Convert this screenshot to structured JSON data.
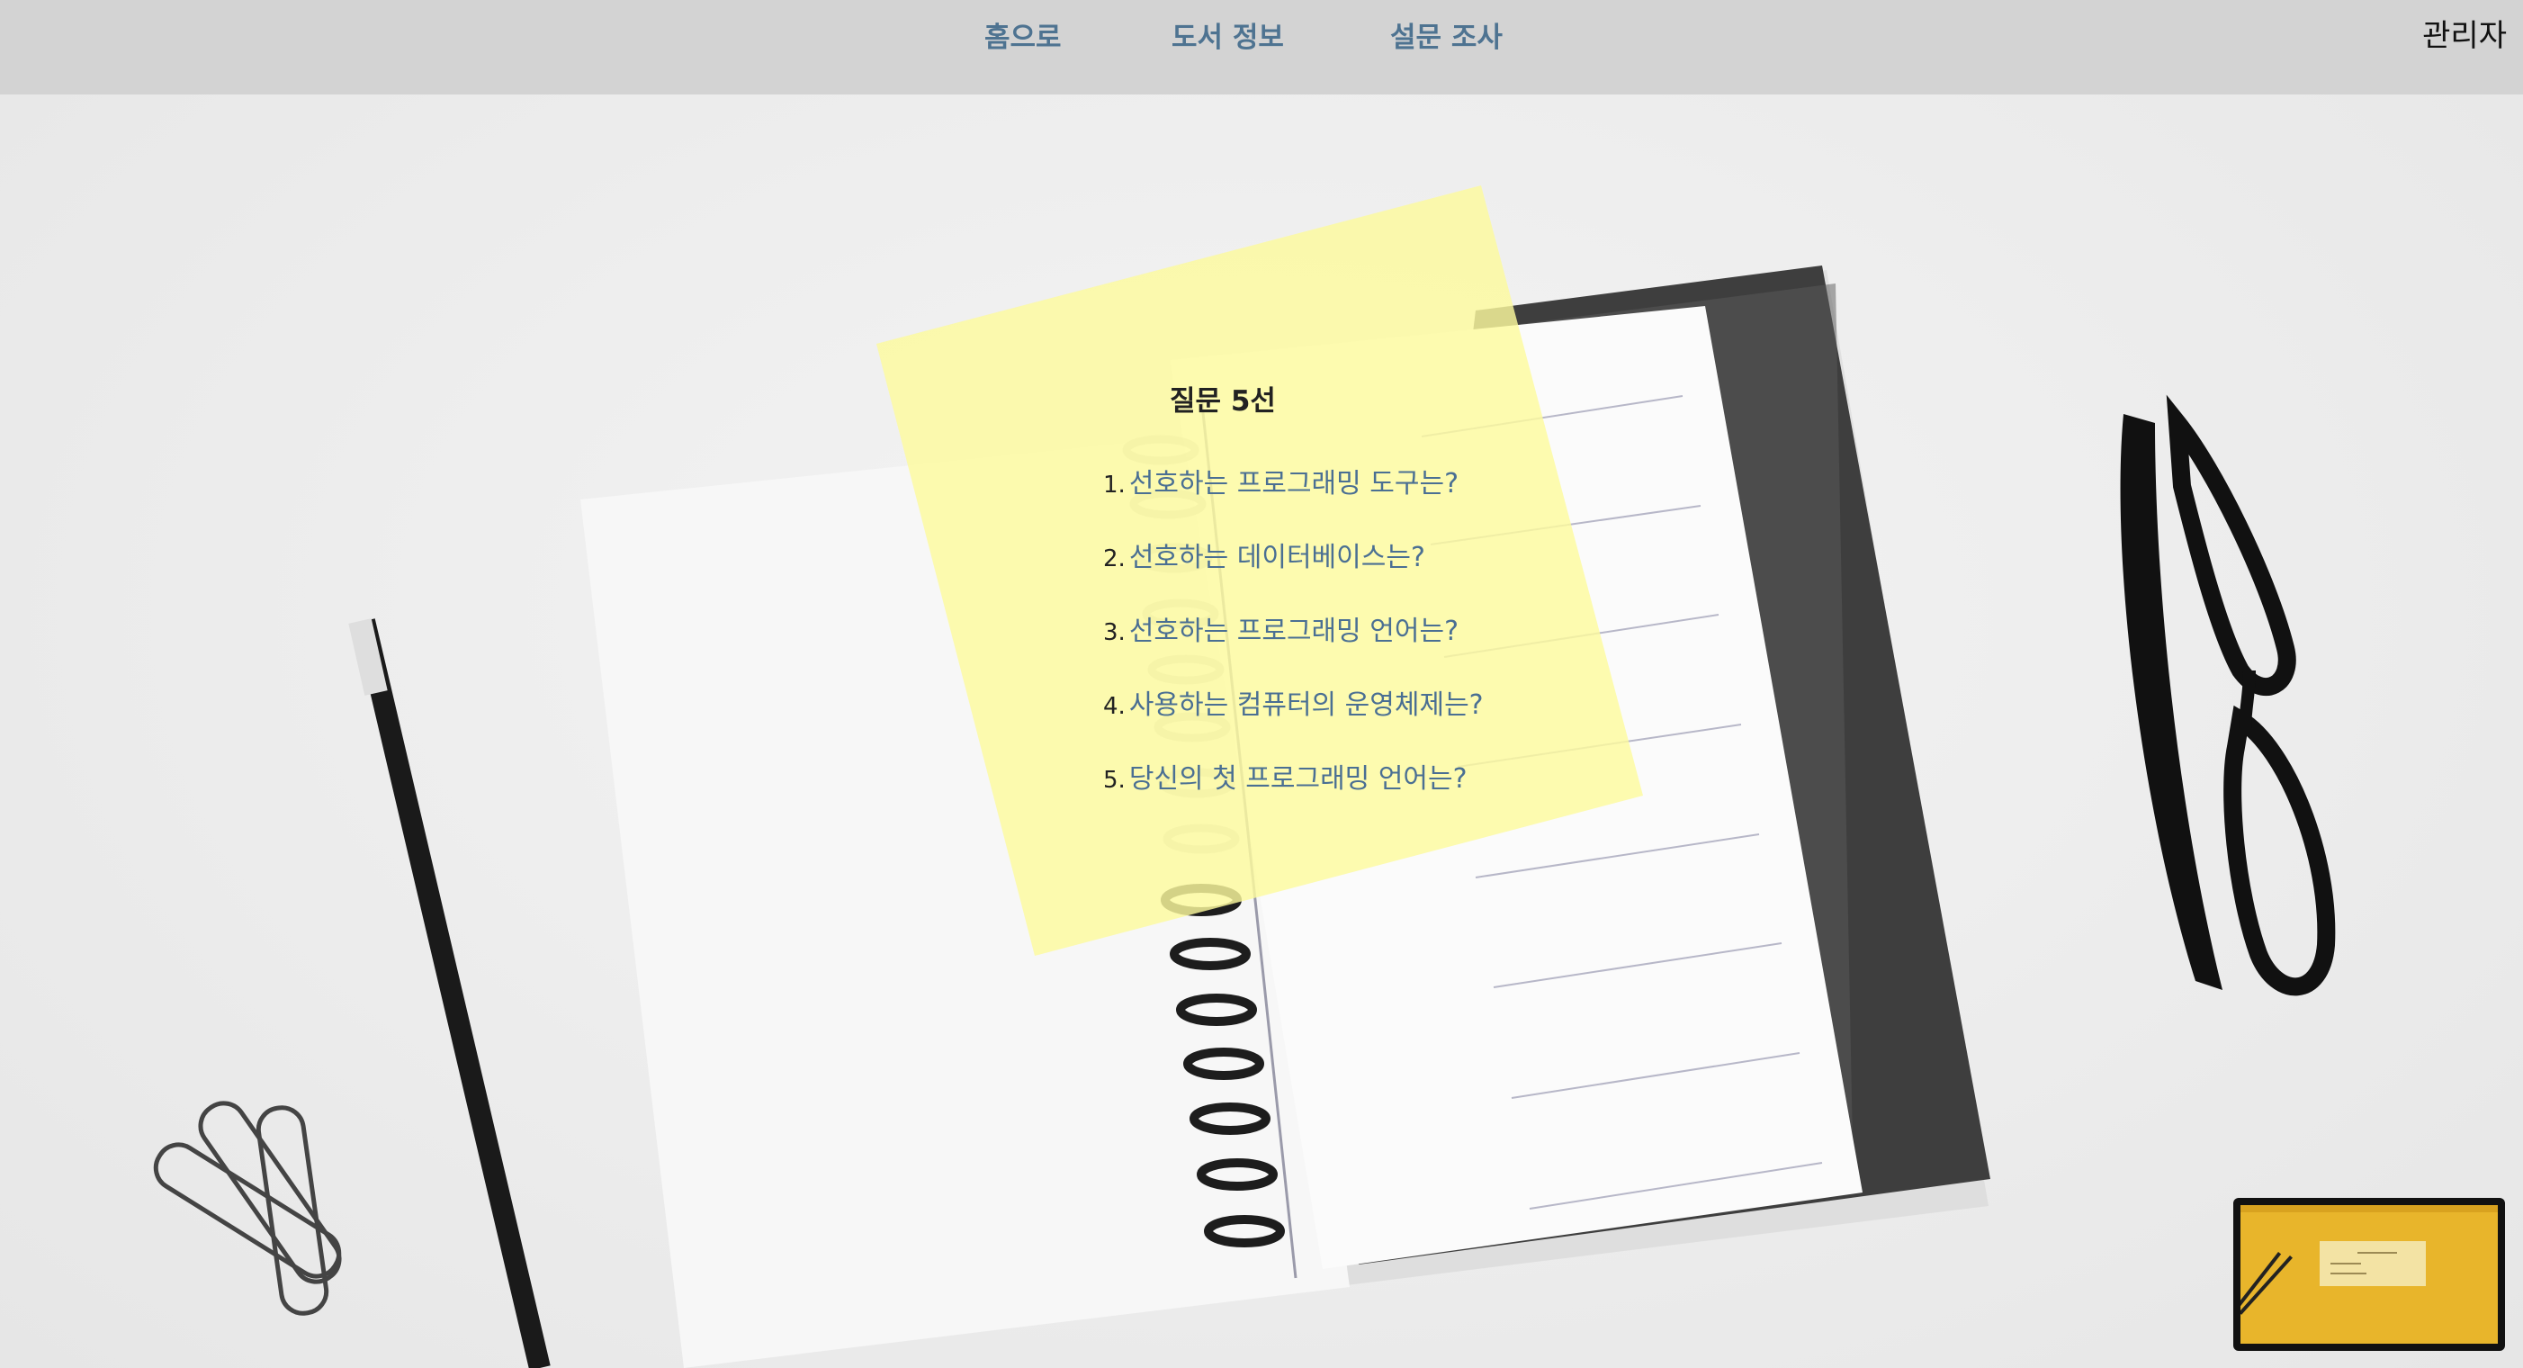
{
  "nav": {
    "items": [
      {
        "label": "홈으로"
      },
      {
        "label": "도서 정보"
      },
      {
        "label": "설문 조사"
      }
    ],
    "admin_label": "관리자"
  },
  "note": {
    "title": "질문 5선",
    "questions": [
      {
        "num": "1.",
        "text": "선호하는 프로그래밍 도구는?"
      },
      {
        "num": "2.",
        "text": "선호하는 데이터베이스는?"
      },
      {
        "num": "3.",
        "text": "선호하는 프로그래밍 언어는?"
      },
      {
        "num": "4.",
        "text": "사용하는 컴퓨터의 운영체제는?"
      },
      {
        "num": "5.",
        "text": "당신의 첫 프로그래밍 언어는?"
      }
    ]
  },
  "colors": {
    "nav_bg": "#d3d3d3",
    "nav_link": "#4e7391",
    "note_yellow": "#fdfa9e",
    "question_link": "#4a6f93",
    "thumbnail_bg": "#e8b52b"
  },
  "icons": {
    "background": "desk-with-notebook-pencil-glasses-clips-image",
    "thumbnail": "desk-background-thumbnail"
  }
}
